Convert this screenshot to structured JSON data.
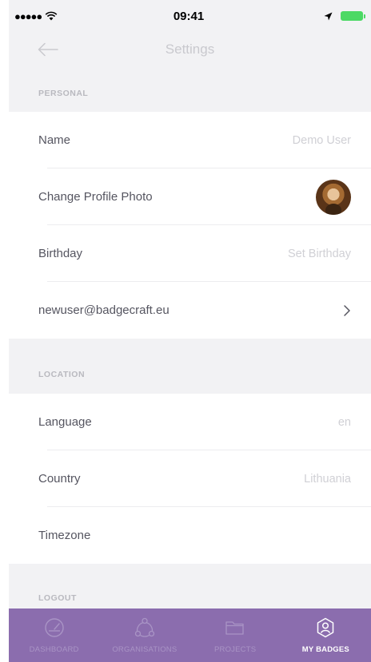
{
  "status": {
    "time": "09:41"
  },
  "nav": {
    "title": "Settings"
  },
  "sections": {
    "personal": "PERSONAL",
    "location": "LOCATION",
    "logout": "LOGOUT"
  },
  "personal_rows": {
    "name": {
      "label": "Name",
      "value": "Demo User"
    },
    "photo": {
      "label": "Change Profile Photo"
    },
    "birthday": {
      "label": "Birthday",
      "value": "Set Birthday"
    },
    "email": {
      "label": "newuser@badgecraft.eu"
    }
  },
  "location_rows": {
    "language": {
      "label": "Language",
      "value": "en"
    },
    "country": {
      "label": "Country",
      "value": "Lithuania"
    },
    "timezone": {
      "label": "Timezone"
    }
  },
  "tabs": [
    {
      "label": "DASHBOARD",
      "icon": "gauge-icon",
      "active": false
    },
    {
      "label": "ORGANISATIONS",
      "icon": "network-icon",
      "active": false
    },
    {
      "label": "PROJECTS",
      "icon": "folder-icon",
      "active": false
    },
    {
      "label": "MY BADGES",
      "icon": "badge-icon",
      "active": true
    }
  ],
  "colors": {
    "accent": "#8b6dae",
    "section_bg": "#f2f2f4",
    "battery": "#4cd964"
  }
}
